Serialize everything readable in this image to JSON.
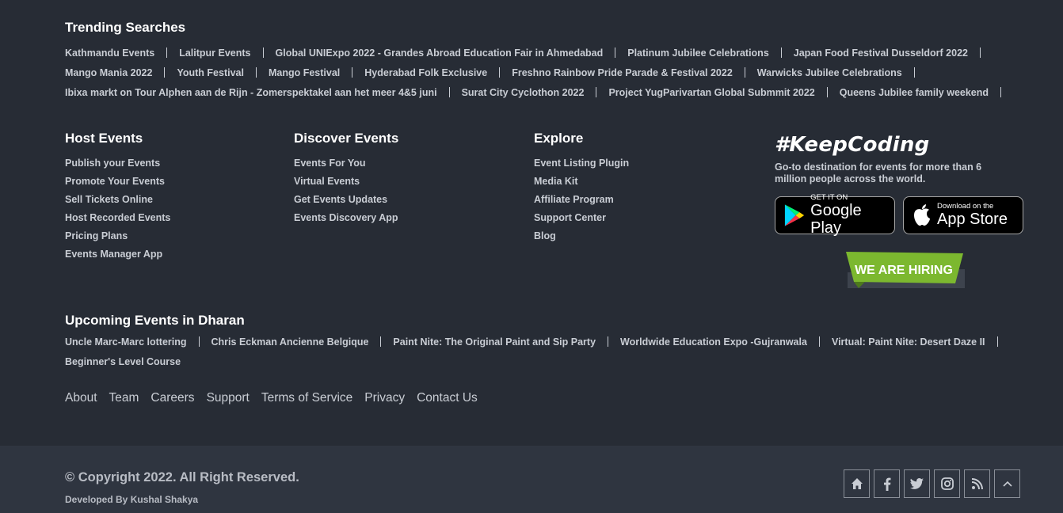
{
  "trending": {
    "title": "Trending Searches",
    "rows": [
      [
        "Kathmandu Events",
        "Lalitpur Events",
        "Global UNIExpo 2022 - Grandes Abroad Education Fair in Ahmedabad",
        "Platinum Jubilee Celebrations",
        "Japan Food Festival Dusseldorf 2022"
      ],
      [
        "Mango Mania 2022",
        "Youth Festival",
        "Mango Festival",
        "Hyderabad Folk Exclusive",
        "Freshno Rainbow Pride Parade & Festival 2022",
        "Warwicks Jubilee Celebrations"
      ],
      [
        "Ibixa markt on Tour Alphen aan de Rijn - Zomerspektakel aan het meer 4&5 juni",
        "Surat City Cyclothon 2022",
        "Project YugParivartan Global Submmit 2022",
        "Queens Jubilee family weekend"
      ]
    ]
  },
  "columns": {
    "host": {
      "title": "Host Events",
      "items": [
        "Publish your Events",
        "Promote Your Events",
        "Sell Tickets Online",
        "Host Recorded Events",
        "Pricing Plans",
        "Events Manager App"
      ]
    },
    "discover": {
      "title": "Discover Events",
      "items": [
        "Events For You",
        "Virtual Events",
        "Get Events Updates",
        "Events Discovery App"
      ]
    },
    "explore": {
      "title": "Explore",
      "items": [
        "Event Listing Plugin",
        "Media Kit",
        "Affiliate Program",
        "Support Center",
        "Blog"
      ]
    }
  },
  "keep": {
    "title": "#KeepCoding",
    "description": "Go-to destination for events for more than 6 million people across the world."
  },
  "stores": {
    "google": {
      "small": "GET IT ON",
      "big": "Google Play"
    },
    "apple": {
      "small": "Download on the",
      "big": "App Store"
    }
  },
  "hiring": {
    "label": "WE ARE HIRING",
    "color": "#7cb82f"
  },
  "upcoming": {
    "title": "Upcoming Events in Dharan",
    "rows": [
      [
        "Uncle Marc-Marc lottering",
        "Chris Eckman Ancienne Belgique",
        "Paint Nite: The Original Paint and Sip Party",
        "Worldwide Education Expo -Gujranwala",
        "Virtual: Paint Nite: Desert Daze II"
      ],
      [
        "Beginner's Level Course"
      ]
    ]
  },
  "bottom_links": [
    "About",
    "Team",
    "Careers",
    "Support",
    "Terms of Service",
    "Privacy",
    "Contact Us"
  ],
  "copyright": "© Copyright 2022. All Right Reserved.",
  "developed": "Developed By Kushal Shakya",
  "social": [
    "home-icon",
    "facebook-icon",
    "twitter-icon",
    "instagram-icon",
    "rss-icon",
    "chevron-up-icon"
  ],
  "colors": {
    "bg": "#272c35",
    "bottom_bg": "#2f3540",
    "text": "#c9cdd4"
  }
}
